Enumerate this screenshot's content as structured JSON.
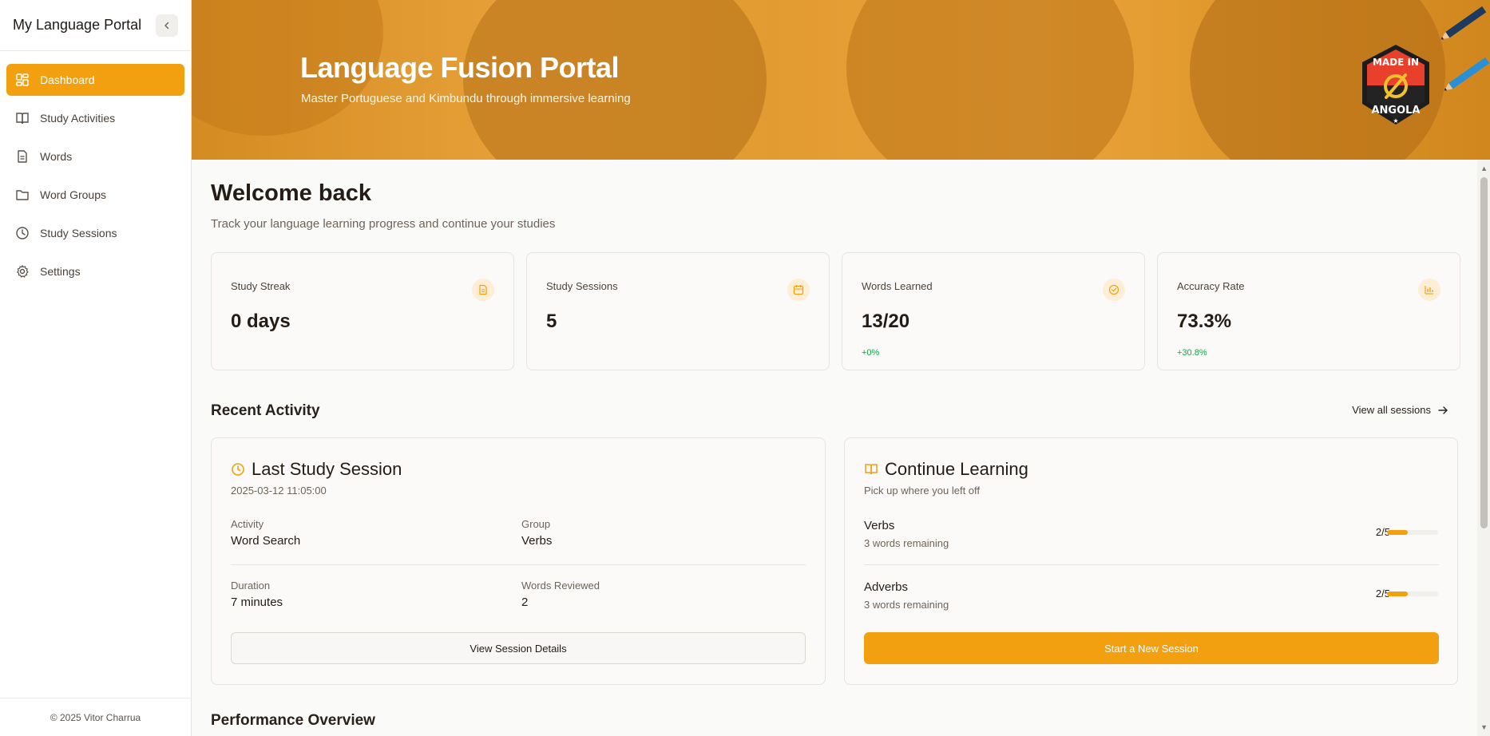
{
  "app_title": "My Language Portal",
  "sidebar": {
    "items": [
      {
        "label": "Dashboard",
        "icon": "dashboard-icon",
        "active": true
      },
      {
        "label": "Study Activities",
        "icon": "book-icon",
        "active": false
      },
      {
        "label": "Words",
        "icon": "document-icon",
        "active": false
      },
      {
        "label": "Word Groups",
        "icon": "folder-icon",
        "active": false
      },
      {
        "label": "Study Sessions",
        "icon": "clock-icon",
        "active": false
      },
      {
        "label": "Settings",
        "icon": "gear-icon",
        "active": false
      }
    ],
    "footer": "© 2025 Vitor Charrua"
  },
  "hero": {
    "title": "Language Fusion Portal",
    "subtitle": "Master Portuguese and Kimbundu through immersive learning",
    "badge": {
      "line1": "MADE IN",
      "line2": "ANGOLA"
    }
  },
  "welcome": {
    "title": "Welcome back",
    "subtitle": "Track your language learning progress and continue your studies"
  },
  "stats": [
    {
      "label": "Study Streak",
      "value": "0 days",
      "delta": "",
      "icon": "document-icon"
    },
    {
      "label": "Study Sessions",
      "value": "5",
      "delta": "",
      "icon": "calendar-icon"
    },
    {
      "label": "Words Learned",
      "value": "13/20",
      "delta": "+0%",
      "icon": "check-circle-icon"
    },
    {
      "label": "Accuracy Rate",
      "value": "73.3%",
      "delta": "+30.8%",
      "icon": "bar-chart-icon"
    }
  ],
  "recent_activity": {
    "title": "Recent Activity",
    "view_all": "View all sessions"
  },
  "last_session": {
    "title": "Last Study Session",
    "timestamp": "2025-03-12 11:05:00",
    "activity_label": "Activity",
    "activity_value": "Word Search",
    "group_label": "Group",
    "group_value": "Verbs",
    "duration_label": "Duration",
    "duration_value": "7 minutes",
    "words_label": "Words Reviewed",
    "words_value": "2",
    "button": "View Session Details"
  },
  "continue_learning": {
    "title": "Continue Learning",
    "subtitle": "Pick up where you left off",
    "groups": [
      {
        "name": "Verbs",
        "remaining": "3 words remaining",
        "count": "2/5",
        "progress": 0.4
      },
      {
        "name": "Adverbs",
        "remaining": "3 words remaining",
        "count": "2/5",
        "progress": 0.4
      }
    ],
    "button": "Start a New Session"
  },
  "performance": {
    "title": "Performance Overview"
  },
  "colors": {
    "accent": "#f29f10",
    "positive": "#16a34a"
  }
}
